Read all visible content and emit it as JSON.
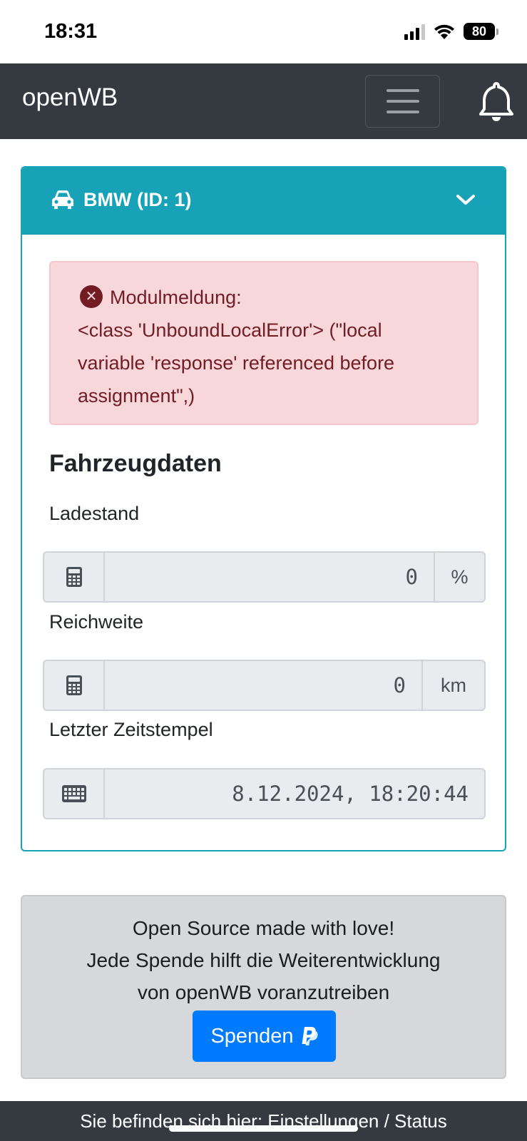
{
  "status_bar": {
    "time": "18:31",
    "battery": "80"
  },
  "navbar": {
    "brand": "openWB",
    "menu_icon": "hamburger-icon",
    "notification_icon": "bell-icon"
  },
  "vehicle_card": {
    "header_icon": "car-icon",
    "title": "BMW (ID: 1)",
    "collapse_icon": "chevron-down-icon",
    "alert": {
      "icon": "error-circle-icon",
      "title": "Modulmeldung:",
      "message": "<class 'UnboundLocalError'> (\"local variable 'response' referenced before assignment\",)"
    },
    "section_title": "Fahrzeugdaten",
    "fields": [
      {
        "label": "Ladestand",
        "icon": "calculator-icon",
        "value": "0",
        "unit": "%"
      },
      {
        "label": "Reichweite",
        "icon": "calculator-icon",
        "value": "0",
        "unit": "km"
      },
      {
        "label": "Letzter Zeitstempel",
        "icon": "keyboard-icon",
        "value": "8.12.2024, 18:20:44",
        "unit": ""
      }
    ]
  },
  "donation": {
    "line1": "Open Source made with love!",
    "line2": "Jede Spende hilft die Weiterentwicklung",
    "line3": "von openWB voranzutreiben",
    "button_label": "Spenden",
    "button_icon": "paypal-icon"
  },
  "footer": {
    "text": "Sie befinden sich hier: Einstellungen / Status"
  },
  "colors": {
    "navbar": "#343a40",
    "card_accent": "#17a2b8",
    "alert_bg": "#f8d7da",
    "alert_text": "#721c24",
    "button_primary": "#007bff"
  }
}
